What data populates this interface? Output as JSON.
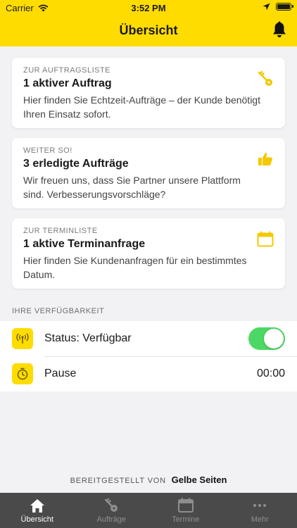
{
  "status_bar": {
    "carrier": "Carrier",
    "time": "3:52 PM",
    "wifi_icon": "wifi-icon",
    "location_icon": "location-arrow-icon",
    "battery_icon": "battery-icon"
  },
  "header": {
    "title": "Übersicht",
    "bell_icon": "bell-icon",
    "background": "#ffdc00"
  },
  "cards": [
    {
      "eyebrow": "ZUR AUFTRAGSLISTE",
      "title": "1 aktiver Auftrag",
      "body": "Hier finden Sie Echtzeit-Aufträge – der Kunde benötigt Ihren Einsatz sofort.",
      "icon": "key-icon"
    },
    {
      "eyebrow": "WEITER SO!",
      "title": "3 erledigte Aufträge",
      "body": "Wir freuen uns, dass Sie Partner unsere Plattform sind. Verbesserungsvorschläge?",
      "icon": "thumbs-up-icon"
    },
    {
      "eyebrow": "ZUR TERMINLISTE",
      "title": "1 aktive Terminanfrage",
      "body": "Hier finden Sie Kundenanfragen für ein bestimmtes Datum.",
      "icon": "calendar-icon"
    }
  ],
  "availability": {
    "section_label": "IHRE VERFÜGBARKEIT",
    "status": {
      "label": "Status: Verfügbar",
      "icon": "broadcast-icon",
      "toggle_on": true,
      "toggle_color": "#4cd864"
    },
    "pause": {
      "label": "Pause",
      "icon": "timer-icon",
      "value": "00:00"
    }
  },
  "footer": {
    "powered_prefix": "BEREITGESTELLT VON",
    "brand": "Gelbe Seiten"
  },
  "tab_bar": {
    "items": [
      {
        "label": "Übersicht",
        "icon": "home-icon",
        "active": true
      },
      {
        "label": "Aufträge",
        "icon": "key-icon",
        "active": false
      },
      {
        "label": "Termine",
        "icon": "calendar-icon",
        "active": false
      },
      {
        "label": "Mehr",
        "icon": "more-dots-icon",
        "active": false
      }
    ]
  },
  "colors": {
    "accent": "#ffdc00",
    "icon_yellow": "#f5c800",
    "tab_bar": "#4a4a4a"
  }
}
